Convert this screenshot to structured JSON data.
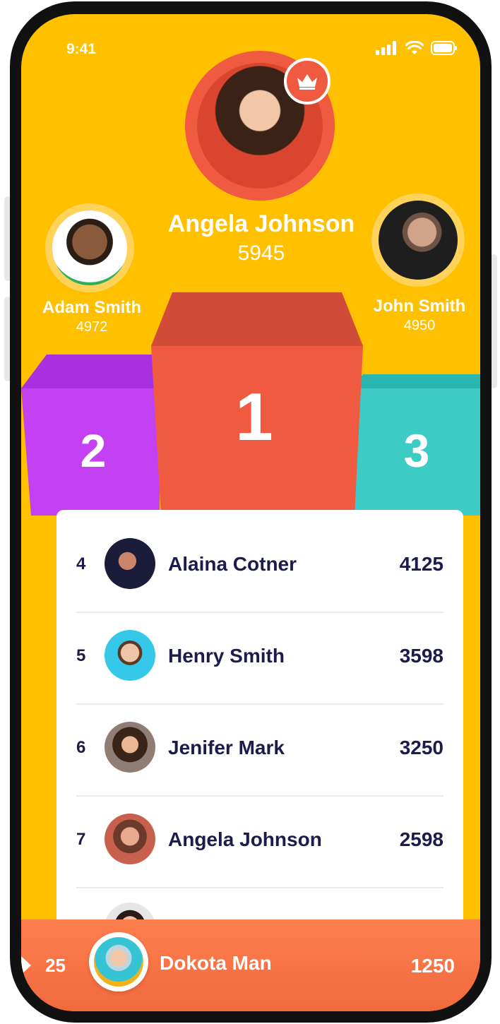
{
  "status_bar": {
    "time": "9:41"
  },
  "podium": {
    "first": {
      "name": "Angela Johnson",
      "score": "5945",
      "place": "1"
    },
    "second": {
      "name": "Adam Smith",
      "score": "4972",
      "place": "2"
    },
    "third": {
      "name": "John Smith",
      "score": "4950",
      "place": "3"
    }
  },
  "leaderboard": [
    {
      "rank": "4",
      "name": "Alaina Cotner",
      "score": "4125"
    },
    {
      "rank": "5",
      "name": "Henry Smith",
      "score": "3598"
    },
    {
      "rank": "6",
      "name": "Jenifer Mark",
      "score": "3250"
    },
    {
      "rank": "7",
      "name": "Angela Johnson",
      "score": "2598"
    }
  ],
  "current_user": {
    "rank": "25",
    "name": "Dokota Man",
    "score": "1250"
  },
  "colors": {
    "background": "#FFC000",
    "first_place": "#F05A41",
    "second_place": "#C341F2",
    "third_place": "#3CCBC5",
    "text_dark": "#1D1B4C",
    "bottom_bar": "#F06A3E"
  },
  "icons": {
    "crown": "crown-icon",
    "signal": "cellular-signal-icon",
    "wifi": "wifi-icon",
    "battery": "battery-icon"
  }
}
